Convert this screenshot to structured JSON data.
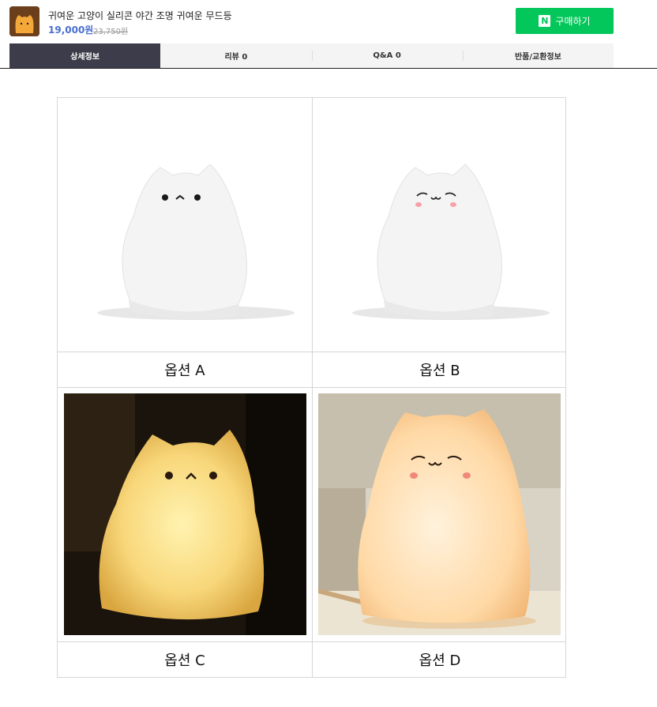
{
  "product": {
    "title": "귀여운 고양이 실리콘 야간 조명 귀여운 무드등",
    "price": "19,000원",
    "original_price": "23,750원",
    "thumbnail": "cat-lamp-thumbnail"
  },
  "buy_button": {
    "logo": "N",
    "label": "구매하기",
    "color": "#03c75a"
  },
  "tabs": [
    {
      "label": "상세정보",
      "active": true
    },
    {
      "label": "리뷰 0",
      "active": false
    },
    {
      "label": "Q&A 0",
      "active": false
    },
    {
      "label": "반품/교환정보",
      "active": false
    }
  ],
  "options": [
    {
      "label": "옵션 A",
      "image": "white-cat-lamp-dot-eyes"
    },
    {
      "label": "옵션 B",
      "image": "white-cat-lamp-smiling-eyes-blush"
    },
    {
      "label": "옵션 C",
      "image": "glowing-yellow-cat-lamp-dot-eyes"
    },
    {
      "label": "옵션 D",
      "image": "glowing-peach-cat-lamp-smiling-eyes-blush"
    }
  ]
}
